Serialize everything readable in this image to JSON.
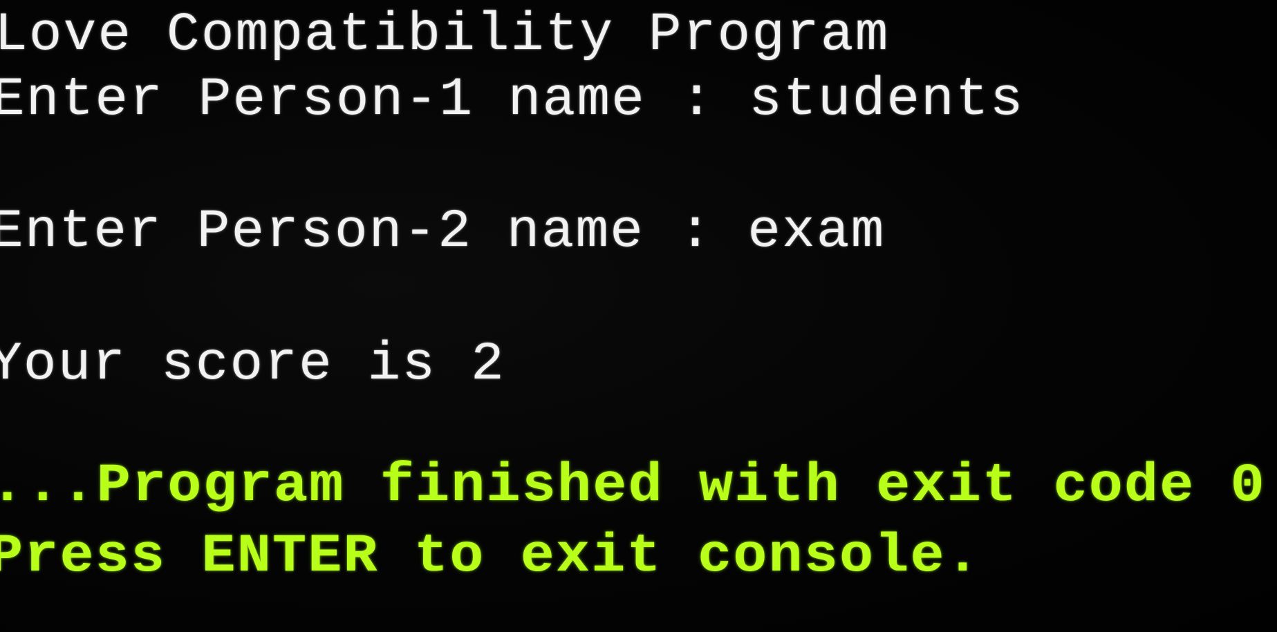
{
  "console": {
    "lines": [
      "Love Compatibility Program",
      "Enter Person-1 name : students",
      "Enter Person-2 name : exam",
      "Your score is 2",
      "...Program finished with exit code 0",
      "Press ENTER to exit console."
    ],
    "text_color": "#f2f2f2",
    "status_color": "#b8ff1a",
    "background_color": "#030303"
  }
}
